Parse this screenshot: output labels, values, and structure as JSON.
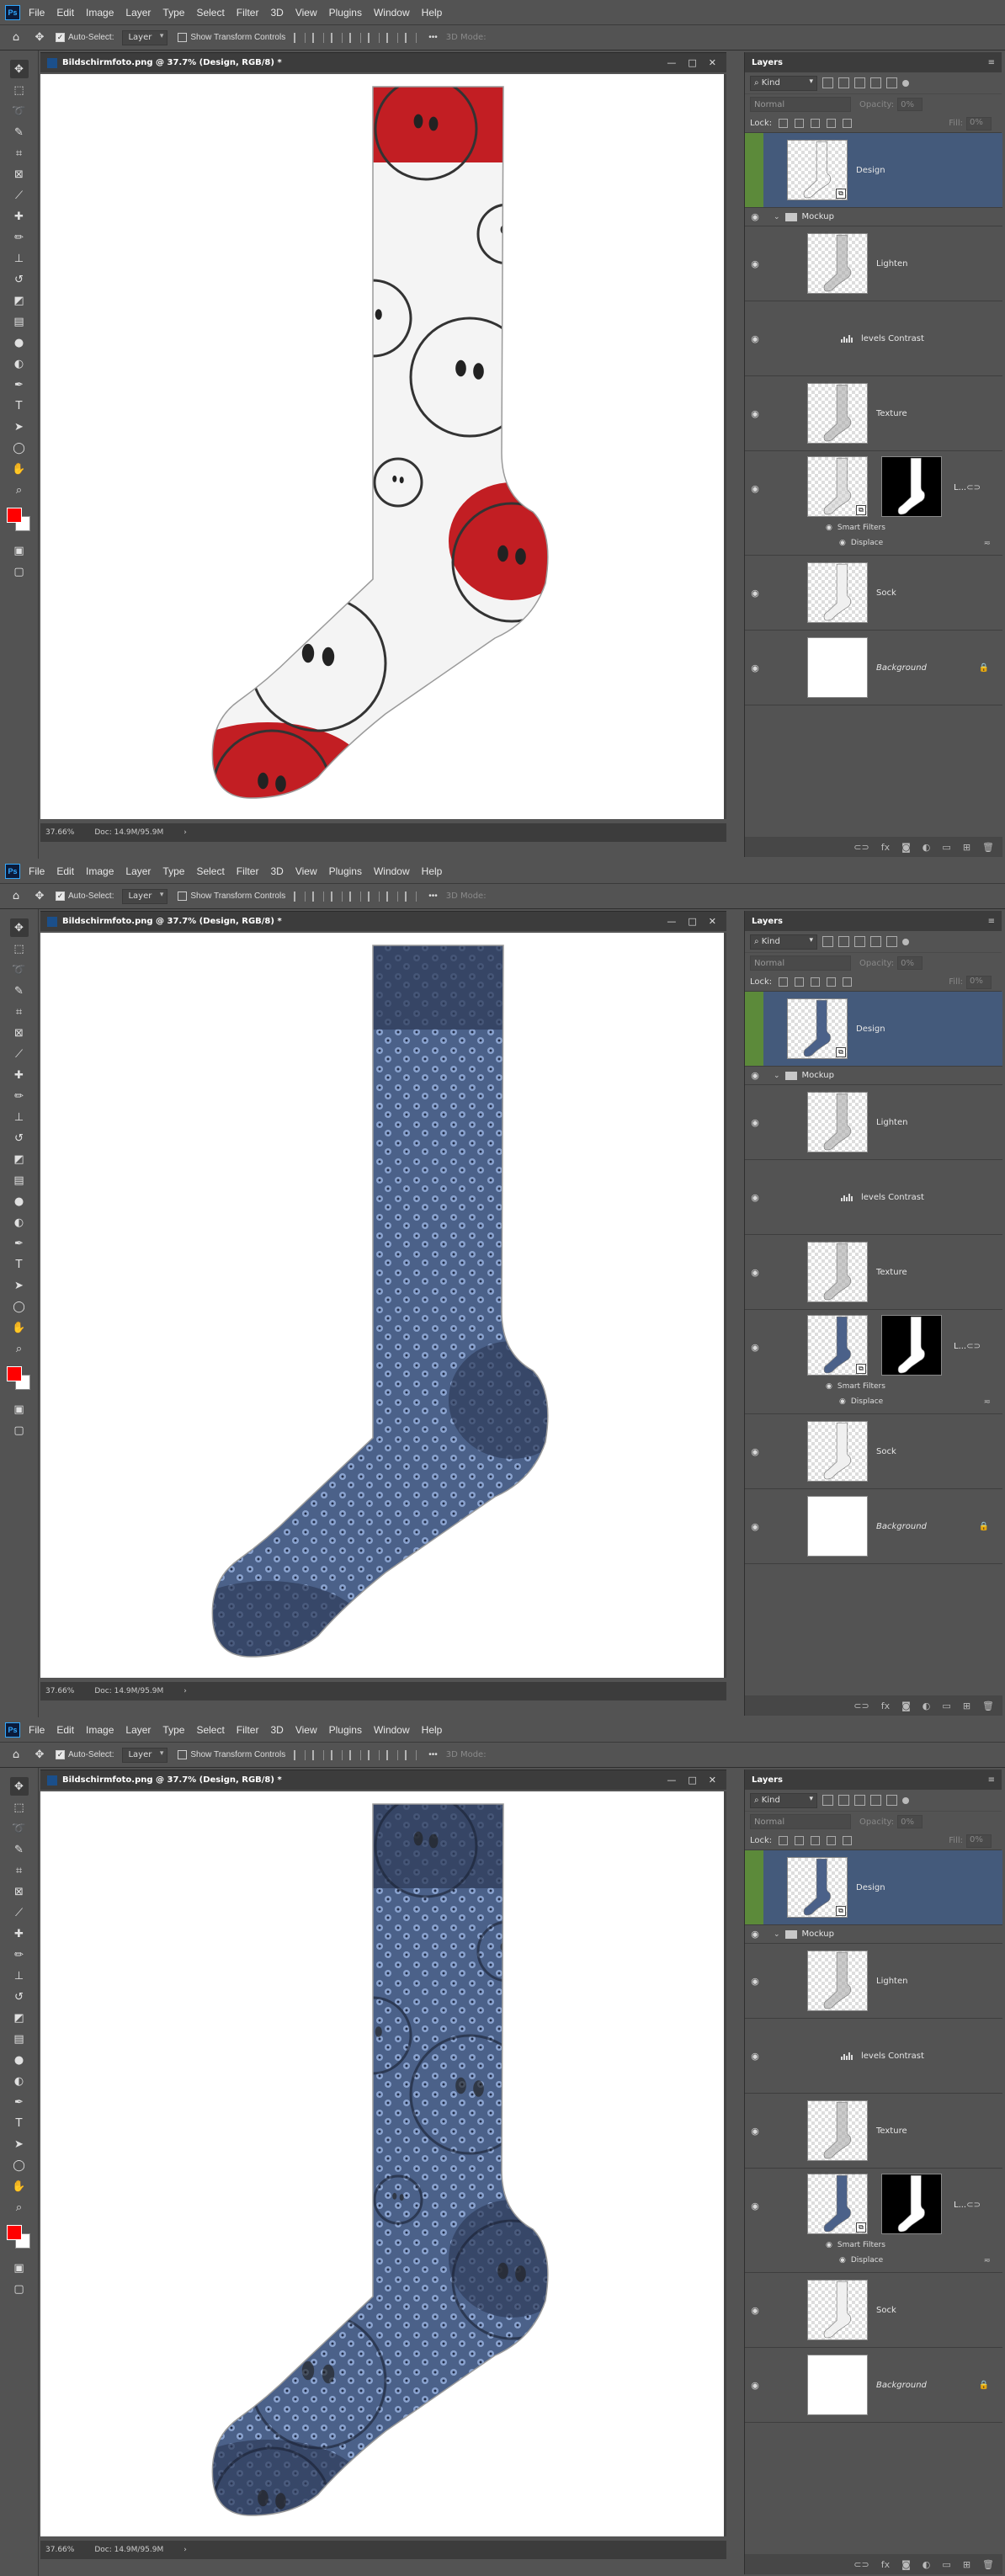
{
  "menu": [
    "File",
    "Edit",
    "Image",
    "Layer",
    "Type",
    "Select",
    "Filter",
    "3D",
    "View",
    "Plugins",
    "Window",
    "Help"
  ],
  "options": {
    "auto_select": "Auto-Select:",
    "auto_select_value": "Layer",
    "transform": "Show Transform Controls",
    "mode_3d": "3D Mode:",
    "more": "•••"
  },
  "document": {
    "title": "Bildschirmfoto.png @ 37.7% (Design, RGB/8) *",
    "zoom": "37.66%",
    "doc_size": "Doc: 14.9M/95.9M"
  },
  "panel": {
    "title": "Layers",
    "kind": "Kind",
    "blend": "Normal",
    "opacity_label": "Opacity:",
    "opacity": "0%",
    "lock_label": "Lock:",
    "fill_label": "Fill:",
    "fill": "0%",
    "layers": {
      "design": "Design",
      "group": "Mockup",
      "lighten": "Lighten",
      "levels": "levels Contrast",
      "texture": "Texture",
      "smart_more": "L...",
      "smart_filters": "Smart Filters",
      "displace": "Displace",
      "sock": "Sock",
      "background": "Background"
    }
  },
  "frames": [
    {
      "variant": "smiley"
    },
    {
      "variant": "blue"
    },
    {
      "variant": "blue-overlay"
    }
  ],
  "colors": {
    "accent_selected": "#445a7b",
    "sock_red": "#c21e23",
    "sock_blue": "#4b6189",
    "sock_cuff": "#2f3c5a"
  }
}
